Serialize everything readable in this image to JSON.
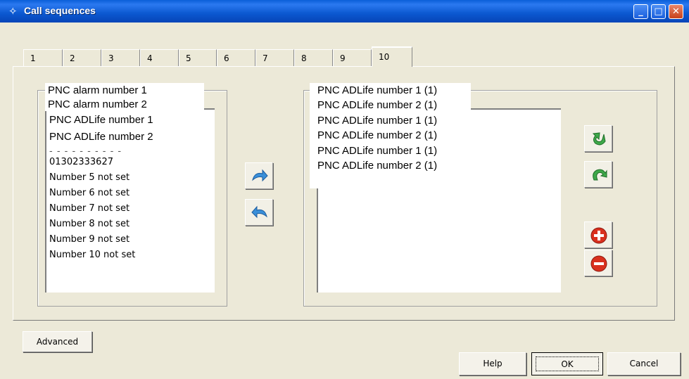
{
  "window": {
    "title": "Call sequences"
  },
  "tabs": [
    "1",
    "2",
    "3",
    "4",
    "5",
    "6",
    "7",
    "8",
    "9",
    "10"
  ],
  "left_list": {
    "items": [
      "PNC alarm number 1",
      "PNC alarm number 2",
      "PNC ADLife number 1",
      "PNC ADLife number 2",
      "01302333627",
      "Number 5 not set",
      "Number 6 not set",
      "Number 7 not set",
      "Number 8 not set",
      "Number 9 not set",
      "Number 10 not set"
    ],
    "overlay_top": [
      "PNC alarm number 1",
      "PNC alarm number 2"
    ]
  },
  "right_list": {
    "items": [
      "PNC ADLife number 1 (1)",
      "PNC ADLife number 2 (1)",
      "PNC ADLife number 1 (1)",
      "PNC ADLife number 2 (1)",
      "PNC ADLife number 1 (1)",
      "PNC ADLife number 2 (1)"
    ]
  },
  "buttons": {
    "advanced": "Advanced",
    "help": "Help",
    "ok": "OK",
    "cancel": "Cancel"
  },
  "colors": {
    "titlebar": "#0a5fd8",
    "face": "#ece9d8",
    "arrow_blue": "#3a8fd9",
    "arrow_green": "#3ea84a",
    "red": "#d9301e"
  }
}
